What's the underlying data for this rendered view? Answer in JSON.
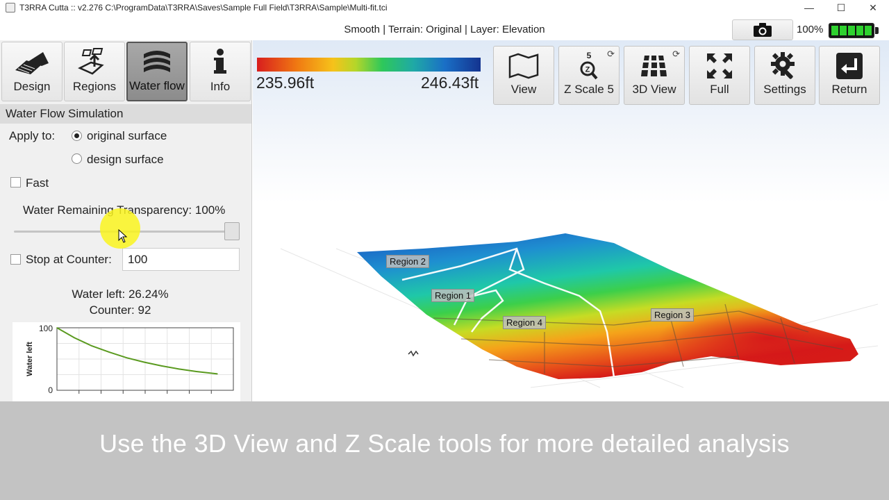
{
  "window": {
    "title": "T3RRA Cutta :: v2.276 C:\\ProgramData\\T3RRA\\Saves\\Sample Full Field\\T3RRA\\Sample\\Multi-fit.tci",
    "minimize": "—",
    "maximize": "☐",
    "close": "✕"
  },
  "status": {
    "text": "Smooth | Terrain: Original | Layer: Elevation",
    "battery_percent": "100%"
  },
  "modes": [
    {
      "label": "Design",
      "icon": "design-icon"
    },
    {
      "label": "Regions",
      "icon": "regions-icon"
    },
    {
      "label": "Water flow",
      "icon": "water-flow-icon"
    },
    {
      "label": "Info",
      "icon": "info-icon"
    }
  ],
  "panel": {
    "title": "Water Flow Simulation",
    "apply_to_label": "Apply to:",
    "option_original": "original surface",
    "option_design": "design surface",
    "fast_label": "Fast",
    "transparency_label": "Water Remaining Transparency: 100%",
    "transparency_value": 1.0,
    "stop_at_counter_label": "Stop at Counter:",
    "stop_at_counter_value": "100",
    "water_left": "Water left: 26.24%",
    "counter": "Counter: 92"
  },
  "chart_data": {
    "type": "line",
    "ylabel": "Water left",
    "y_ticks": [
      "100",
      "0"
    ],
    "ylim": [
      0,
      100
    ],
    "x": [
      0,
      10,
      20,
      30,
      40,
      50,
      60,
      70,
      80,
      92
    ],
    "series": [
      {
        "values": [
          100,
          84,
          71,
          61,
          52,
          45,
          39,
          34,
          30,
          26.24
        ]
      }
    ],
    "grid": true,
    "line_color": "#5a9a1f"
  },
  "legend": {
    "min": "235.96ft",
    "max": "246.43ft"
  },
  "toolbar": [
    {
      "label": "View",
      "icon": "map-view-icon"
    },
    {
      "label": "Z Scale 5",
      "icon": "z-scale-icon",
      "badge": "5"
    },
    {
      "label": "3D View",
      "icon": "3d-grid-icon"
    },
    {
      "label": "Full",
      "icon": "fullscreen-icon"
    },
    {
      "label": "Settings",
      "icon": "gear-icon"
    },
    {
      "label": "Return",
      "icon": "return-icon"
    }
  ],
  "regions": [
    "Region 2",
    "Region 1",
    "Region 4",
    "Region 3"
  ],
  "caption": "Use the 3D View and Z Scale tools for more detailed analysis",
  "colors": {
    "accent_active": "#8c8c8c",
    "battery": "#2fd12f",
    "highlight": "#faf51e"
  }
}
